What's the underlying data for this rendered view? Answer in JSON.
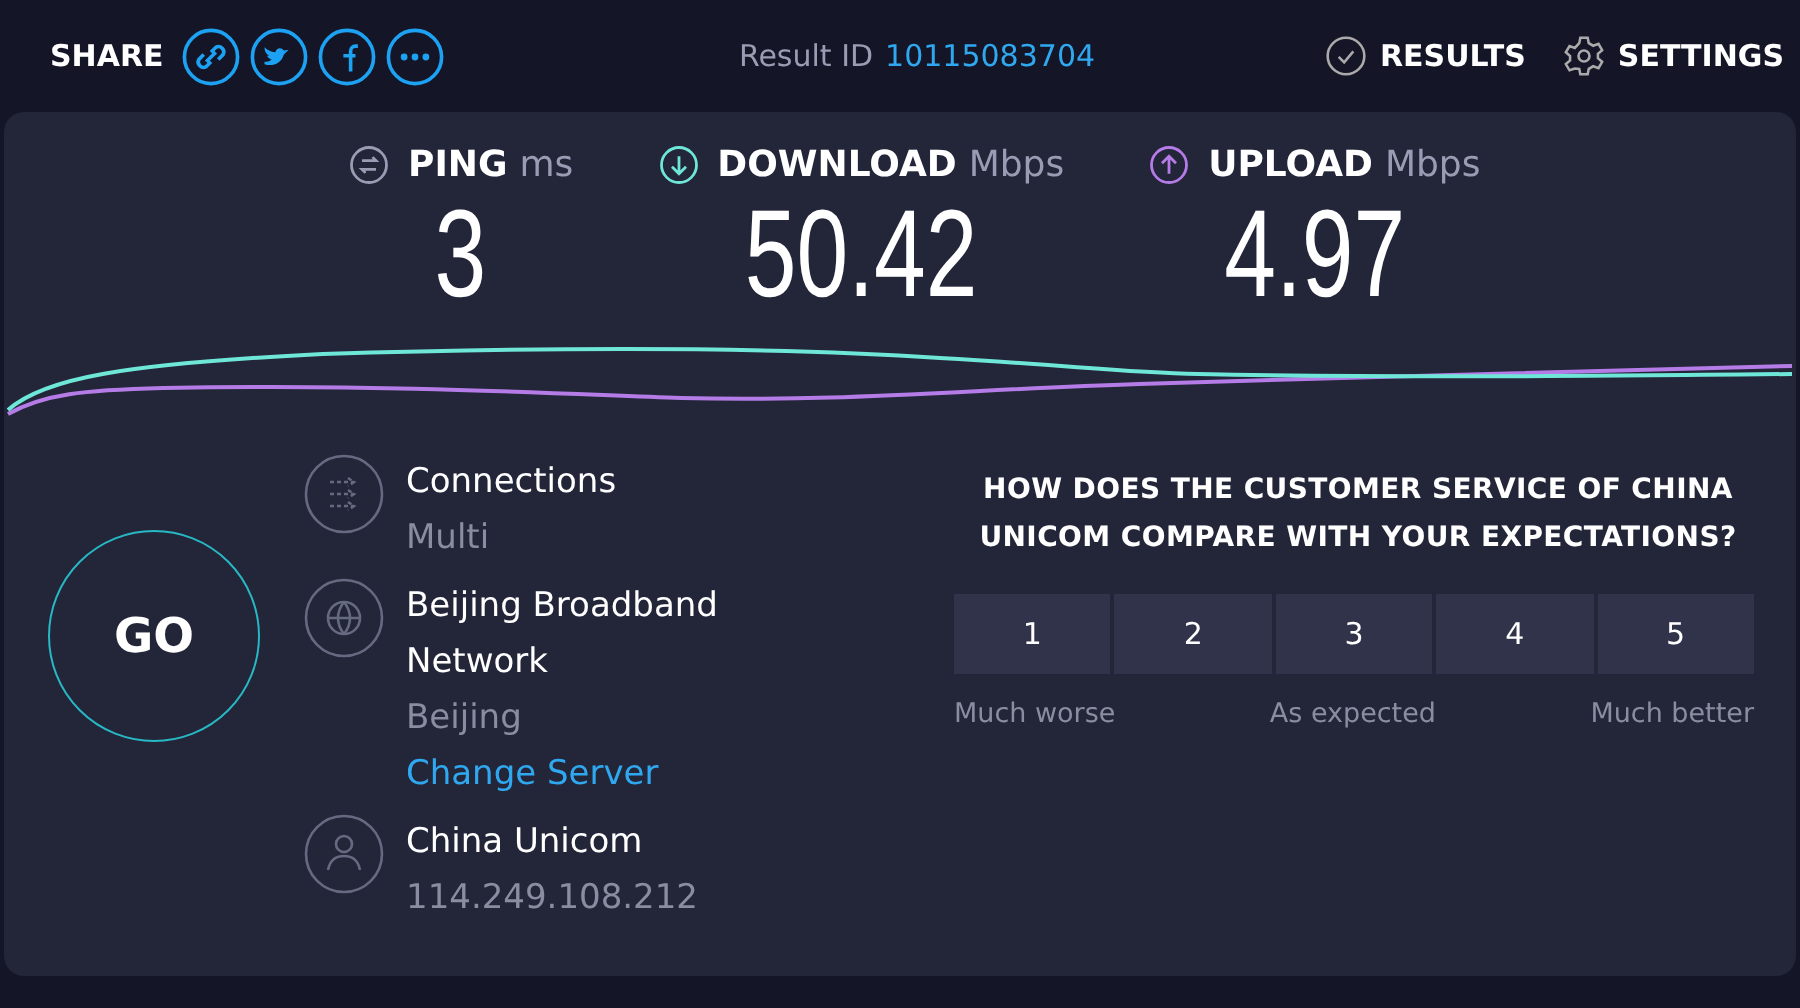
{
  "header": {
    "share_label": "SHARE",
    "result_label": "Result ID",
    "result_id": "10115083704",
    "nav": [
      {
        "kind": "results",
        "label": "RESULTS"
      },
      {
        "kind": "settings",
        "label": "SETTINGS"
      }
    ]
  },
  "metrics": [
    {
      "kind": "ping",
      "label": "PING",
      "unit": "ms",
      "value": "3"
    },
    {
      "kind": "download",
      "label": "DOWNLOAD",
      "unit": "Mbps",
      "value": "50.42"
    },
    {
      "kind": "upload",
      "label": "UPLOAD",
      "unit": "Mbps",
      "value": "4.97"
    }
  ],
  "go_button": "GO",
  "server_info": [
    {
      "kind": "connections",
      "title": "Connections",
      "detail": "Multi"
    },
    {
      "kind": "server",
      "title": "Beijing Broadband Network",
      "detail": "Beijing",
      "link": "Change Server"
    },
    {
      "kind": "provider",
      "title": "China Unicom",
      "detail": "114.249.108.212"
    }
  ],
  "survey": {
    "question": "HOW DOES THE CUSTOMER SERVICE OF CHINA UNICOM COMPARE WITH YOUR EXPECTATIONS?",
    "options": [
      "1",
      "2",
      "3",
      "4",
      "5"
    ],
    "scale_labels": [
      "Much worse",
      "As expected",
      "Much better"
    ]
  }
}
